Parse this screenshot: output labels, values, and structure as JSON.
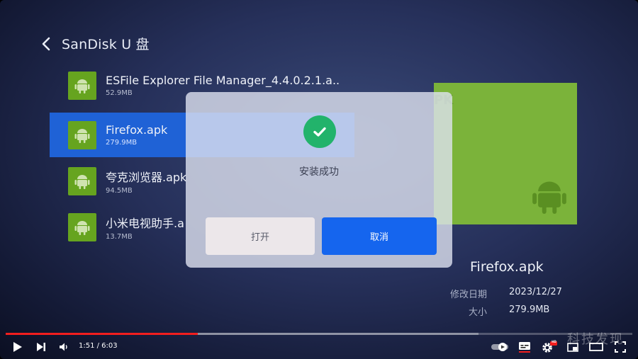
{
  "header": {
    "title": "SanDisk U 盘"
  },
  "files": [
    {
      "name": "ESFile Explorer File Manager_4.4.0.2.1.a..",
      "size": "52.9MB",
      "selected": false
    },
    {
      "name": "Firefox.apk",
      "size": "279.9MB",
      "selected": true
    },
    {
      "name": "夸克浏览器.apk",
      "size": "94.5MB",
      "selected": false
    },
    {
      "name": "小米电视助手.a",
      "size": "13.7MB",
      "selected": false
    }
  ],
  "preview": {
    "tag": "PK",
    "icon": "android-icon"
  },
  "info": {
    "name": "Firefox.apk",
    "modified_label": "修改日期",
    "modified_value": "2023/12/27",
    "size_label": "大小",
    "size_value": "279.9MB"
  },
  "dialog": {
    "icon": "check-circle-icon",
    "message": "安装成功",
    "open_label": "打开",
    "cancel_label": "取消"
  },
  "player": {
    "time": "1:51 / 6:03",
    "progress": 0.306,
    "buffered": 0.755,
    "hd_badge": "HD",
    "accent": "#f21e1e"
  },
  "watermark": "科技发现",
  "colors": {
    "selected_row": "#1f62d6",
    "apk_green": "#66a41f",
    "success": "#22b36b",
    "primary_button": "#1565ee"
  }
}
